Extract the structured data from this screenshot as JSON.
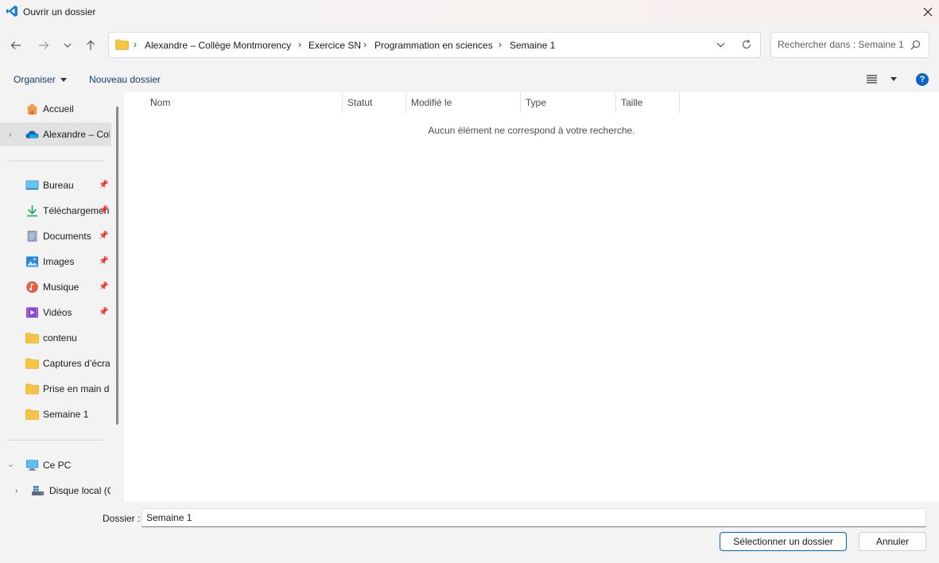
{
  "window": {
    "title": "Ouvrir un dossier",
    "app_icon": "vscode-icon",
    "close_icon": "close-icon"
  },
  "navigation": {
    "back_icon": "arrow-left-icon",
    "forward_icon": "arrow-right-icon",
    "recent_icon": "chevron-down-icon",
    "up_icon": "arrow-up-icon"
  },
  "address": {
    "breadcrumbs": [
      "Alexandre – Collège Montmorency",
      "Exercice SN",
      "Programmation en sciences",
      "Semaine 1"
    ]
  },
  "search": {
    "placeholder": "Rechercher dans : Semaine 1"
  },
  "commands": {
    "organize": "Organiser",
    "new_folder": "Nouveau dossier",
    "help": "?"
  },
  "sidebar": {
    "quick": [
      {
        "label": "Accueil",
        "icon": "home-icon"
      },
      {
        "label": "Alexandre – Collège Montmorency",
        "icon": "onedrive-cloud-icon"
      }
    ],
    "pinned": [
      {
        "label": "Bureau",
        "icon": "desktop-icon"
      },
      {
        "label": "Téléchargements",
        "icon": "download-icon"
      },
      {
        "label": "Documents",
        "icon": "documents-icon"
      },
      {
        "label": "Images",
        "icon": "pictures-icon"
      },
      {
        "label": "Musique",
        "icon": "music-icon"
      },
      {
        "label": "Vidéos",
        "icon": "videos-icon"
      },
      {
        "label": "contenu",
        "icon": "folder-icon"
      },
      {
        "label": "Captures d’écran",
        "icon": "folder-icon"
      },
      {
        "label": "Prise en main de",
        "icon": "folder-icon"
      },
      {
        "label": "Semaine 1",
        "icon": "folder-icon"
      }
    ],
    "devices": [
      {
        "label": "Ce PC",
        "icon": "computer-icon"
      },
      {
        "label": "Disque local (C:)",
        "icon": "drive-icon"
      }
    ]
  },
  "table": {
    "columns": [
      "Nom",
      "Statut",
      "Modifié le",
      "Type",
      "Taille"
    ],
    "empty_message": "Aucun élément ne correspond à votre recherche."
  },
  "footer": {
    "folder_label": "Dossier :",
    "folder_value": "Semaine 1",
    "select_button": "Sélectionner un dossier",
    "cancel_button": "Annuler"
  }
}
